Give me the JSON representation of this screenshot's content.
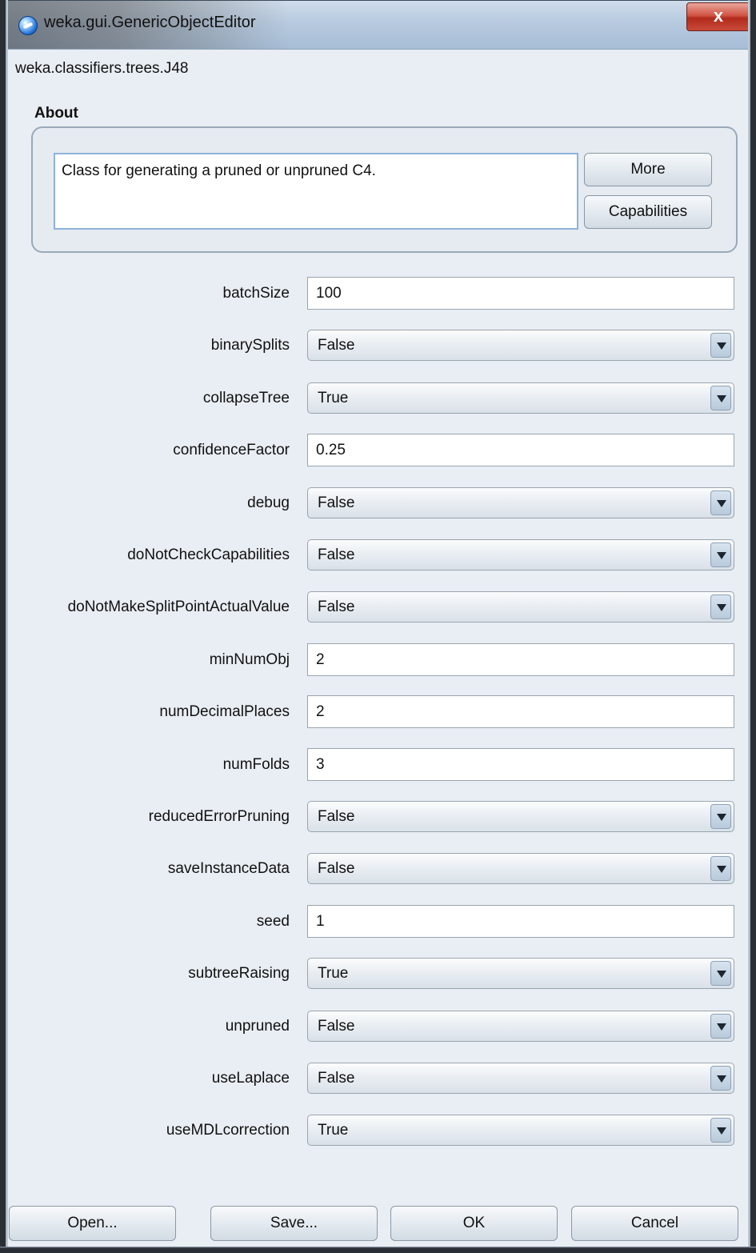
{
  "window": {
    "title": "weka.gui.GenericObjectEditor",
    "close_glyph": "x",
    "class_name": "weka.classifiers.trees.J48"
  },
  "about": {
    "label": "About",
    "text": "Class for generating a pruned or unpruned C4.",
    "more_label": "More",
    "capabilities_label": "Capabilities"
  },
  "properties": [
    {
      "label": "batchSize",
      "kind": "text",
      "value": "100"
    },
    {
      "label": "binarySplits",
      "kind": "combo",
      "value": "False"
    },
    {
      "label": "collapseTree",
      "kind": "combo",
      "value": "True"
    },
    {
      "label": "confidenceFactor",
      "kind": "text",
      "value": "0.25"
    },
    {
      "label": "debug",
      "kind": "combo",
      "value": "False"
    },
    {
      "label": "doNotCheckCapabilities",
      "kind": "combo",
      "value": "False"
    },
    {
      "label": "doNotMakeSplitPointActualValue",
      "kind": "combo",
      "value": "False"
    },
    {
      "label": "minNumObj",
      "kind": "text",
      "value": "2"
    },
    {
      "label": "numDecimalPlaces",
      "kind": "text",
      "value": "2"
    },
    {
      "label": "numFolds",
      "kind": "text",
      "value": "3"
    },
    {
      "label": "reducedErrorPruning",
      "kind": "combo",
      "value": "False"
    },
    {
      "label": "saveInstanceData",
      "kind": "combo",
      "value": "False"
    },
    {
      "label": "seed",
      "kind": "text",
      "value": "1"
    },
    {
      "label": "subtreeRaising",
      "kind": "combo",
      "value": "True"
    },
    {
      "label": "unpruned",
      "kind": "combo",
      "value": "False"
    },
    {
      "label": "useLaplace",
      "kind": "combo",
      "value": "False"
    },
    {
      "label": "useMDLcorrection",
      "kind": "combo",
      "value": "True"
    }
  ],
  "buttons": {
    "open": "Open...",
    "save": "Save...",
    "ok": "OK",
    "cancel": "Cancel"
  }
}
